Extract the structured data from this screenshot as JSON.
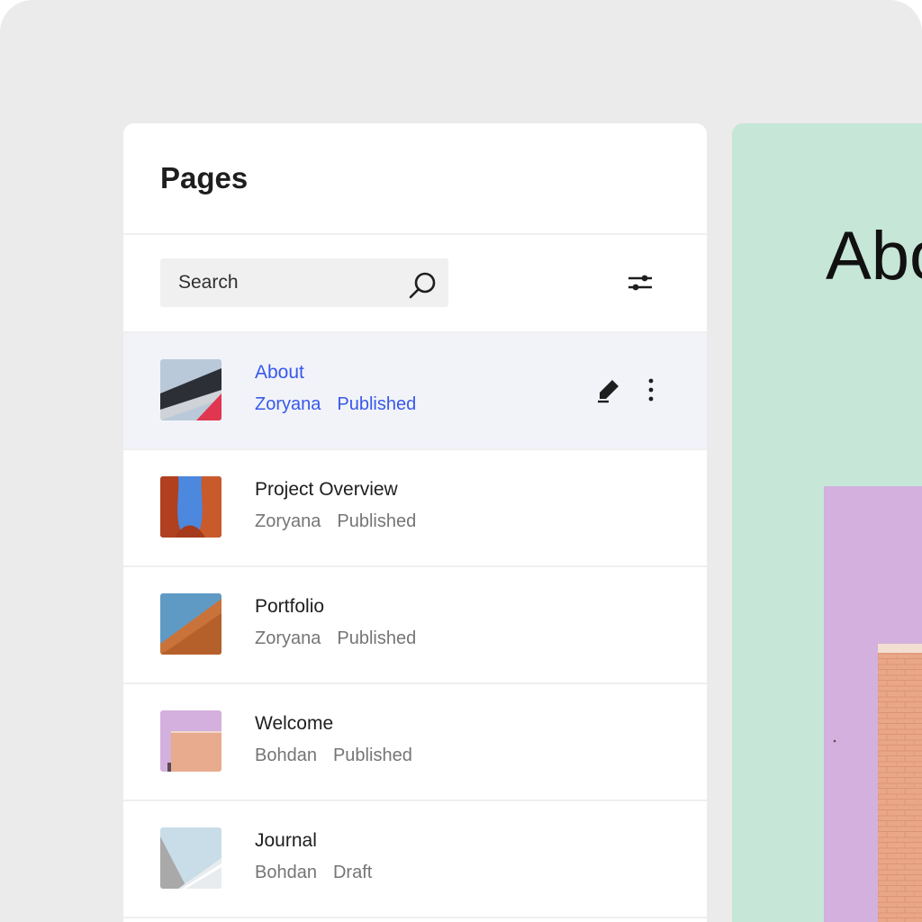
{
  "sidebar": {
    "title": "Pages",
    "search": {
      "placeholder": "Search",
      "value": ""
    },
    "filter_icon": "sliders-icon",
    "pages": [
      {
        "title": "About",
        "author": "Zoryana",
        "status": "Published",
        "selected": true
      },
      {
        "title": "Project Overview",
        "author": "Zoryana",
        "status": "Published"
      },
      {
        "title": "Portfolio",
        "author": "Zoryana",
        "status": "Published"
      },
      {
        "title": "Welcome",
        "author": "Bohdan",
        "status": "Published"
      },
      {
        "title": "Journal",
        "author": "Bohdan",
        "status": "Draft"
      }
    ],
    "row_actions": {
      "edit_icon": "pencil-icon",
      "more_icon": "more-vertical-icon"
    }
  },
  "preview": {
    "heading": "About"
  },
  "colors": {
    "accent": "#3858e9",
    "selected_row_bg": "#f1f3f9",
    "preview_bg": "#c6e6d8",
    "frame_bg": "#ebebeb"
  }
}
